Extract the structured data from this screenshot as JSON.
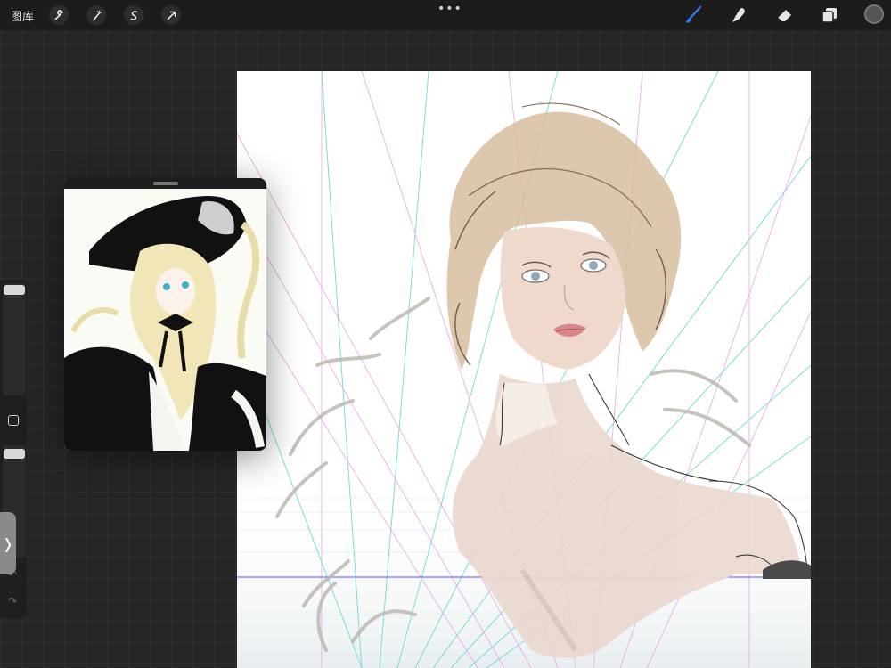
{
  "topbar": {
    "gallery_label": "图库",
    "more_label": "•••",
    "left_tools": [
      {
        "name": "wrench-icon",
        "glyph": "🔧"
      },
      {
        "name": "magic-wand-icon",
        "glyph": "✎"
      },
      {
        "name": "selection-icon",
        "glyph": "S"
      },
      {
        "name": "transform-arrow-icon",
        "glyph": "➚"
      }
    ],
    "right_tools": [
      "brush-icon",
      "smudge-icon",
      "eraser-icon",
      "layers-icon"
    ],
    "active_color": "#555555",
    "brush_accent": "#2f7bf5"
  },
  "sidebar": {
    "undo_glyph": "↶",
    "redo_glyph": "↷",
    "tab_glyph": "❭"
  },
  "colors": {
    "guide_cyan": "#6fd9d3",
    "guide_magenta": "#e6a6e6",
    "horizon": "#5b55e6"
  }
}
